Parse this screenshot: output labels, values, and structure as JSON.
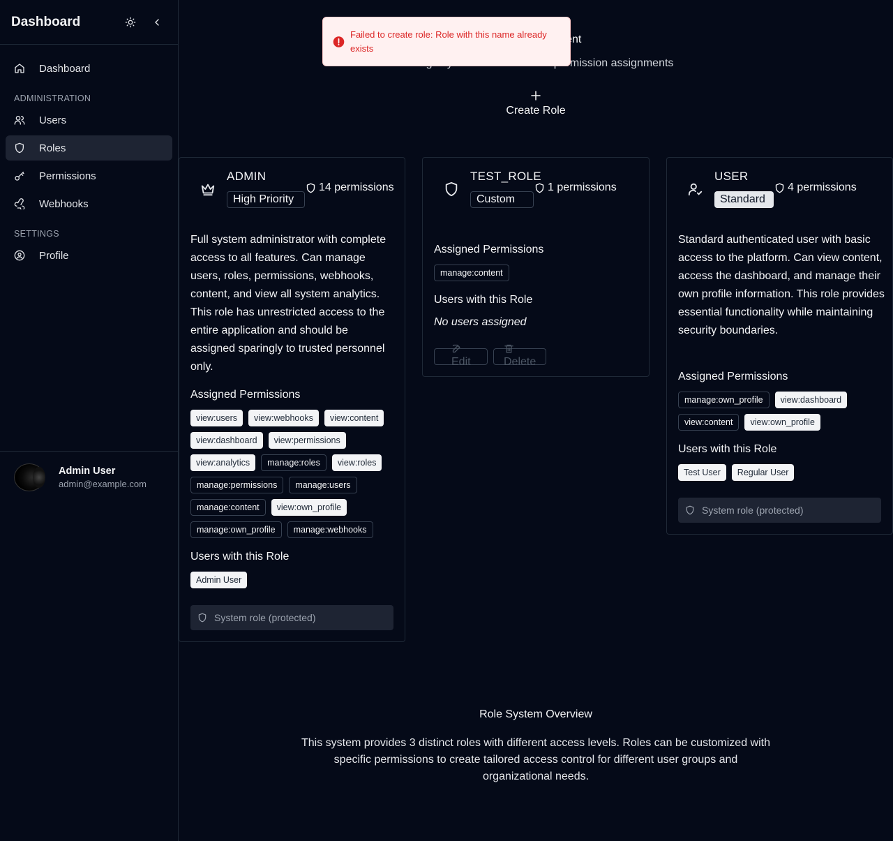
{
  "sidebar": {
    "title": "Dashboard",
    "nav_top": {
      "label": "Dashboard",
      "icon": "home-icon"
    },
    "sections": [
      {
        "label": "ADMINISTRATION",
        "items": [
          {
            "label": "Users",
            "icon": "users-icon"
          },
          {
            "label": "Roles",
            "icon": "shield-icon",
            "active": true
          },
          {
            "label": "Permissions",
            "icon": "key-icon"
          },
          {
            "label": "Webhooks",
            "icon": "webhook-icon"
          }
        ]
      },
      {
        "label": "SETTINGS",
        "items": [
          {
            "label": "Profile",
            "icon": "user-circle-icon"
          }
        ]
      }
    ],
    "user": {
      "name": "Admin User",
      "email": "admin@example.com"
    }
  },
  "header": {
    "title": "Role Management",
    "subtitle": "Manage system roles and their permission assignments",
    "create_label": "Create Role"
  },
  "toast": {
    "message": "Failed to create role: Role with this name already exists",
    "color": "#dc2626"
  },
  "roles": [
    {
      "name": "ADMIN",
      "icon": "crown-icon",
      "badge": "High Priority",
      "permission_count": "14 permissions",
      "description": "Full system administrator with complete access to all features. Can manage users, roles, permissions, webhooks, content, and view all system analytics. This role has unrestricted access to the entire application and should be assigned sparingly to trusted personnel only.",
      "assigned_label": "Assigned Permissions",
      "permissions": [
        {
          "name": "view:users",
          "style": "light"
        },
        {
          "name": "view:webhooks",
          "style": "light"
        },
        {
          "name": "view:content",
          "style": "light"
        },
        {
          "name": "view:dashboard",
          "style": "light"
        },
        {
          "name": "view:permissions",
          "style": "light"
        },
        {
          "name": "view:analytics",
          "style": "light"
        },
        {
          "name": "manage:roles",
          "style": "dark"
        },
        {
          "name": "view:roles",
          "style": "light"
        },
        {
          "name": "manage:permissions",
          "style": "dark"
        },
        {
          "name": "manage:users",
          "style": "dark"
        },
        {
          "name": "manage:content",
          "style": "dark"
        },
        {
          "name": "view:own_profile",
          "style": "light"
        },
        {
          "name": "manage:own_profile",
          "style": "dark"
        },
        {
          "name": "manage:webhooks",
          "style": "dark"
        }
      ],
      "users_label": "Users with this Role",
      "users": [
        "Admin User"
      ],
      "protected_label": "System role (protected)"
    },
    {
      "name": "TEST_ROLE",
      "icon": "shield-icon",
      "badge": "Custom",
      "permission_count": "1 permissions",
      "assigned_label": "Assigned Permissions",
      "permissions": [
        {
          "name": "manage:content",
          "style": "dark"
        }
      ],
      "users_label": "Users with this Role",
      "no_users": "No users assigned",
      "edit_label": "Edit",
      "delete_label": "Delete"
    },
    {
      "name": "USER",
      "icon": "user-check-icon",
      "badge": "Standard",
      "permission_count": "4 permissions",
      "description": "Standard authenticated user with basic access to the platform. Can view content, access the dashboard, and manage their own profile information. This role provides essential functionality while maintaining security boundaries.",
      "assigned_label": "Assigned Permissions",
      "permissions": [
        {
          "name": "manage:own_profile",
          "style": "dark"
        },
        {
          "name": "view:dashboard",
          "style": "light"
        },
        {
          "name": "view:content",
          "style": "dark"
        },
        {
          "name": "view:own_profile",
          "style": "light"
        }
      ],
      "users_label": "Users with this Role",
      "users": [
        "Test User",
        "Regular User"
      ],
      "protected_label": "System role (protected)"
    }
  ],
  "overview": {
    "title": "Role System Overview",
    "text": "This system provides 3 distinct roles with different access levels. Roles can be customized with specific permissions to create tailored access control for different user groups and organizational needs."
  }
}
